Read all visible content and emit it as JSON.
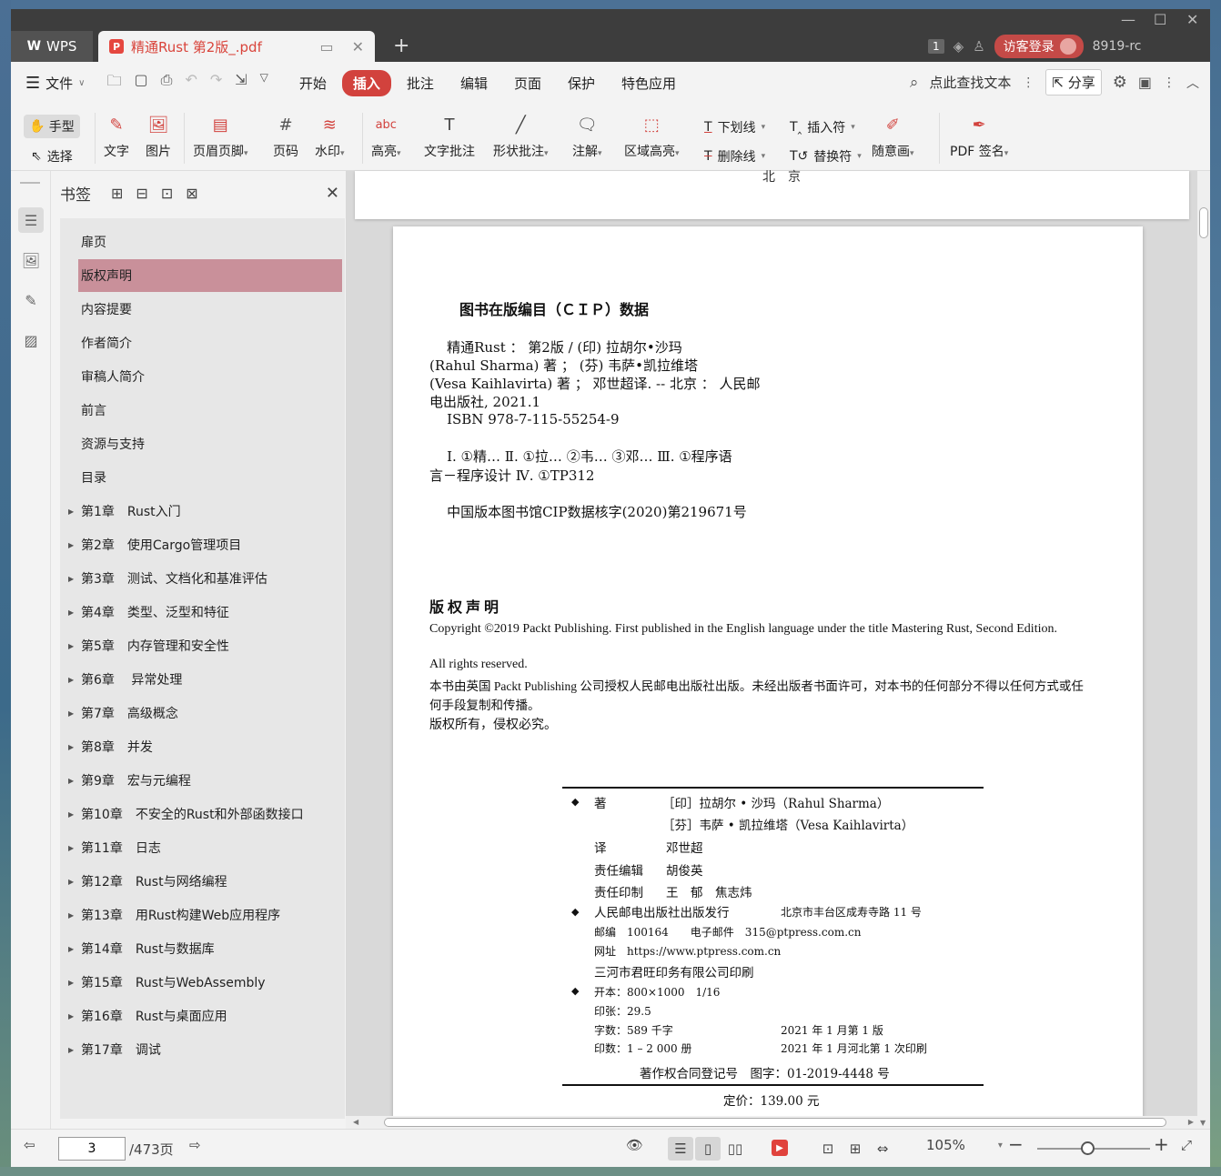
{
  "titlebar": {
    "app_tab": "WPS",
    "doc_tab": "精通Rust 第2版_.pdf",
    "badge": "1",
    "login": "访客登录",
    "version": "8919-rc"
  },
  "menubar": {
    "file": "文件",
    "items": [
      "开始",
      "插入",
      "批注",
      "编辑",
      "页面",
      "保护",
      "特色应用"
    ],
    "active": "插入",
    "search": "点此查找文本",
    "share": "分享"
  },
  "ribbon": {
    "hand": "手型",
    "select": "选择",
    "text": "文字",
    "image": "图片",
    "header_footer": "页眉页脚",
    "page_num": "页码",
    "watermark": "水印",
    "highlight": "高亮",
    "text_comment": "文字批注",
    "shape_comment": "形状批注",
    "annotation": "注解",
    "area_highlight": "区域高亮",
    "underline": "下划线",
    "strikethrough": "删除线",
    "insert_char": "插入符",
    "replace_char": "替换符",
    "freehand": "随意画",
    "pdf_sign": "PDF 签名"
  },
  "bookmarks": {
    "title": "书签",
    "items": [
      {
        "label": "扉页",
        "expandable": false
      },
      {
        "label": "版权声明",
        "expandable": false,
        "selected": true
      },
      {
        "label": "内容提要",
        "expandable": false
      },
      {
        "label": "作者简介",
        "expandable": false
      },
      {
        "label": "审稿人简介",
        "expandable": false
      },
      {
        "label": "前言",
        "expandable": false
      },
      {
        "label": "资源与支持",
        "expandable": false
      },
      {
        "label": "目录",
        "expandable": false
      },
      {
        "label": "第1章　Rust入门",
        "expandable": true
      },
      {
        "label": "第2章　使用Cargo管理项目",
        "expandable": true
      },
      {
        "label": "第3章　测试、文档化和基准评估",
        "expandable": true
      },
      {
        "label": "第4章　类型、泛型和特征",
        "expandable": true
      },
      {
        "label": "第5章　内存管理和安全性",
        "expandable": true
      },
      {
        "label": "第6章　 异常处理",
        "expandable": true
      },
      {
        "label": "第7章　高级概念",
        "expandable": true
      },
      {
        "label": "第8章　并发",
        "expandable": true
      },
      {
        "label": "第9章　宏与元编程",
        "expandable": true
      },
      {
        "label": "第10章　不安全的Rust和外部函数接口",
        "expandable": true
      },
      {
        "label": "第11章　日志",
        "expandable": true
      },
      {
        "label": "第12章　Rust与网络编程",
        "expandable": true
      },
      {
        "label": "第13章　用Rust构建Web应用程序",
        "expandable": true
      },
      {
        "label": "第14章　Rust与数据库",
        "expandable": true
      },
      {
        "label": "第15章　Rust与WebAssembly",
        "expandable": true
      },
      {
        "label": "第16章　Rust与桌面应用",
        "expandable": true
      },
      {
        "label": "第17章　调试",
        "expandable": true
      }
    ]
  },
  "document": {
    "prev_page_footer": "北　京",
    "cip_title": "图书在版编目（ＣＩＰ）数据",
    "cip_lines": [
      "    精通Rust ： 第2版 / (印) 拉胡尔•沙玛",
      "(Rahul Sharma) 著 ； (芬) 韦萨•凯拉维塔",
      "(Vesa Kaihlavirta) 著 ； 邓世超译. -- 北京 ： 人民邮",
      "电出版社, 2021.1",
      "    ISBN 978-7-115-55254-9",
      "    Ⅰ. ①精… Ⅱ. ①拉… ②韦… ③邓… Ⅲ. ①程序语",
      "言－程序设计 Ⅳ. ①TP312",
      "    中国版本图书馆CIP数据核字(2020)第219671号"
    ],
    "copyright_title": "版权声明",
    "copyright_lines": [
      "Copyright ©2019 Packt Publishing. First published in the English language under the title Mastering Rust, Second Edition.",
      "All rights reserved.",
      "本书由英国 Packt Publishing 公司授权人民邮电出版社出版。未经出版者书面许可，对本书的任何部分不得以任何方式或任何手段复制和传播。",
      "版权所有，侵权必究。"
    ],
    "colophon": {
      "author_label": "著",
      "author1": "［印］拉胡尔 • 沙玛（Rahul Sharma）",
      "author2": "［芬］韦萨 • 凯拉维塔（Vesa Kaihlavirta）",
      "translator_label": "译",
      "translator": "邓世超",
      "editor_label": "责任编辑",
      "editor": "胡俊英",
      "print_label": "责任印制",
      "print_staff": "王　郁　焦志炜",
      "publisher": "人民邮电出版社出版发行",
      "address": "北京市丰台区成寿寺路 11 号",
      "postcode": "邮编　100164　　电子邮件　315@ptpress.com.cn",
      "website": "网址　https://www.ptpress.com.cn",
      "printer": "三河市君旺印务有限公司印刷",
      "format": "开本：800×1000　1/16",
      "sheets": "印张：29.5",
      "words": "字数：589 千字",
      "edition": "2021 年 1 月第 1 版",
      "copies": "印数：1 – 2 000 册",
      "printing": "2021 年 1 月河北第 1 次印刷",
      "registration": "著作权合同登记号　图字：01-2019-4448 号",
      "price": "定价：139.00 元"
    }
  },
  "statusbar": {
    "current_page": "3",
    "total_pages": "/473页",
    "zoom": "105%"
  }
}
